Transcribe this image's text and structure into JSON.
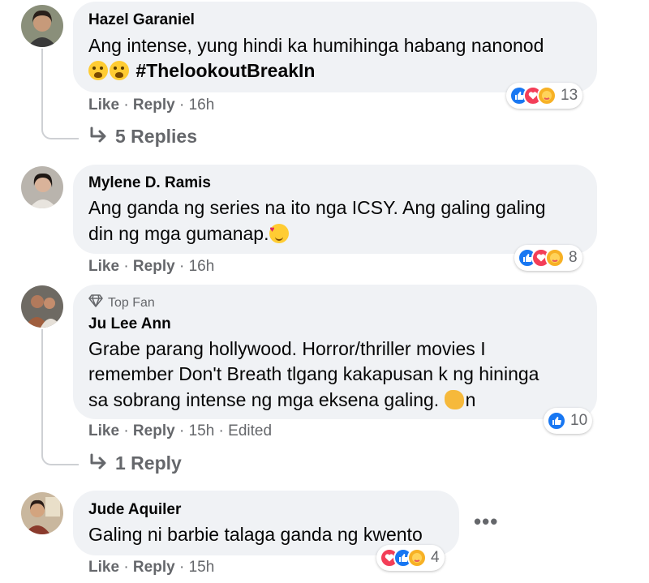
{
  "comments": [
    {
      "author": "Hazel Garaniel",
      "line1": "Ang intense, yung hindi ka humihinga habang nanonod",
      "hashtag": "#ThelookoutBreakIn",
      "like": "Like",
      "reply": "Reply",
      "time": "16h",
      "reaction_count": "13",
      "replies_label": "5 Replies"
    },
    {
      "author": "Mylene D. Ramis",
      "line1": "Ang ganda ng series na ito nga ICSY. Ang galing galing",
      "line2": "din ng mga gumanap.",
      "like": "Like",
      "reply": "Reply",
      "time": "16h",
      "reaction_count": "8"
    },
    {
      "badge": "Top Fan",
      "author": "Ju Lee Ann",
      "line1": "Grabe parang hollywood. Horror/thriller movies I",
      "line2": "remember Don't Breath tlgang kakapusan k ng hininga",
      "line3": "sa sobrang intense ng mga eksena galing.",
      "line3_tail": "n",
      "like": "Like",
      "reply": "Reply",
      "time": "15h",
      "edited": "Edited",
      "reaction_count": "10",
      "replies_label": "1 Reply"
    },
    {
      "author": "Jude Aquiler",
      "line1": "Galing ni barbie talaga ganda ng kwento",
      "like": "Like",
      "reply": "Reply",
      "time": "15h",
      "reaction_count": "4",
      "more_label": "•••"
    }
  ],
  "separator": "·",
  "icons": {
    "reply_arrow": "reply-arrow-icon",
    "top_fan": "diamond-icon",
    "reactions": [
      "like-icon",
      "love-icon",
      "care-icon"
    ]
  },
  "colors": {
    "bubble": "#f0f2f5",
    "meta_text": "#65676b",
    "like_blue": "#1877f2",
    "love_red": "#f33e58",
    "care_yellow": "#f7b125"
  }
}
